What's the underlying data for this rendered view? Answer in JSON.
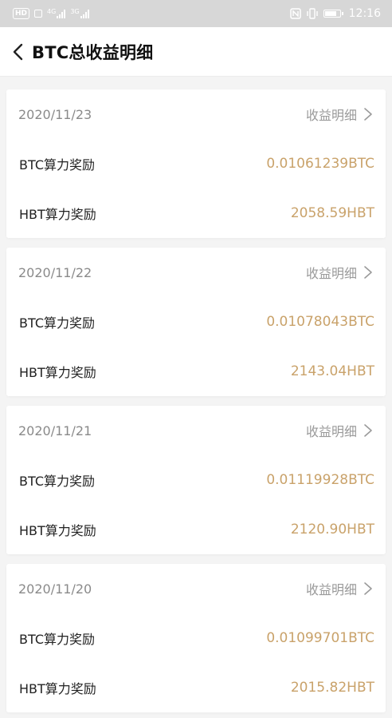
{
  "status_bar": {
    "hd_label": "HD",
    "net_label_1": "4G",
    "net_label_2": "3G",
    "time": "12:16"
  },
  "header": {
    "title": "BTC总收益明细",
    "back_icon": "chevron-left-icon"
  },
  "accent_color": "#c9a26a",
  "records": [
    {
      "date": "2020/11/23",
      "detail_label": "收益明细",
      "btc_label": "BTC算力奖励",
      "btc_value": "0.01061239BTC",
      "hbt_label": "HBT算力奖励",
      "hbt_value": "2058.59HBT"
    },
    {
      "date": "2020/11/22",
      "detail_label": "收益明细",
      "btc_label": "BTC算力奖励",
      "btc_value": "0.01078043BTC",
      "hbt_label": "HBT算力奖励",
      "hbt_value": "2143.04HBT"
    },
    {
      "date": "2020/11/21",
      "detail_label": "收益明细",
      "btc_label": "BTC算力奖励",
      "btc_value": "0.01119928BTC",
      "hbt_label": "HBT算力奖励",
      "hbt_value": "2120.90HBT"
    },
    {
      "date": "2020/11/20",
      "detail_label": "收益明细",
      "btc_label": "BTC算力奖励",
      "btc_value": "0.01099701BTC",
      "hbt_label": "HBT算力奖励",
      "hbt_value": "2015.82HBT"
    }
  ]
}
